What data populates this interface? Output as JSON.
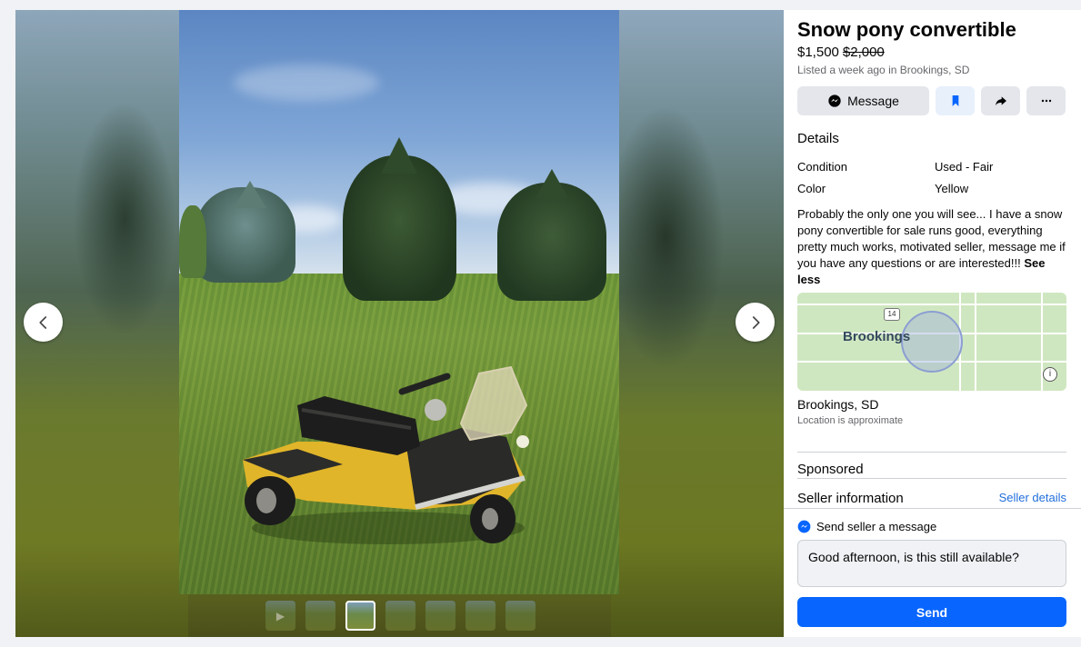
{
  "listing": {
    "title": "Snow pony convertible",
    "price": "$1,500",
    "original_price": "$2,000",
    "listed_text": "Listed a week ago in Brookings, SD"
  },
  "actions": {
    "message_label": "Message",
    "save_icon": "bookmark-icon",
    "share_icon": "share-icon",
    "more_icon": "more-icon"
  },
  "details": {
    "heading": "Details",
    "rows": [
      {
        "key": "Condition",
        "value": "Used - Fair"
      },
      {
        "key": "Color",
        "value": "Yellow"
      }
    ],
    "description": "Probably the only one you will see... I have a snow pony convertible for sale runs good, everything pretty much works, motivated seller, message me if you have any questions or are interested!!!",
    "see_less": "See less"
  },
  "map": {
    "city_label": "Brookings",
    "highway_number": "14",
    "info_label": "i"
  },
  "location": {
    "name": "Brookings, SD",
    "note": "Location is approximate"
  },
  "sponsored": "Sponsored",
  "seller": {
    "heading": "Seller information",
    "details_link": "Seller details"
  },
  "messaging": {
    "heading": "Send seller a message",
    "message_text": "Good afternoon, is this still available?",
    "send_label": "Send"
  },
  "gallery": {
    "thumbnail_count": 7,
    "active_index": 2,
    "first_is_video": true
  },
  "colors": {
    "accent": "#0866ff",
    "link": "#216fdb",
    "secondary_text": "#65676b"
  }
}
